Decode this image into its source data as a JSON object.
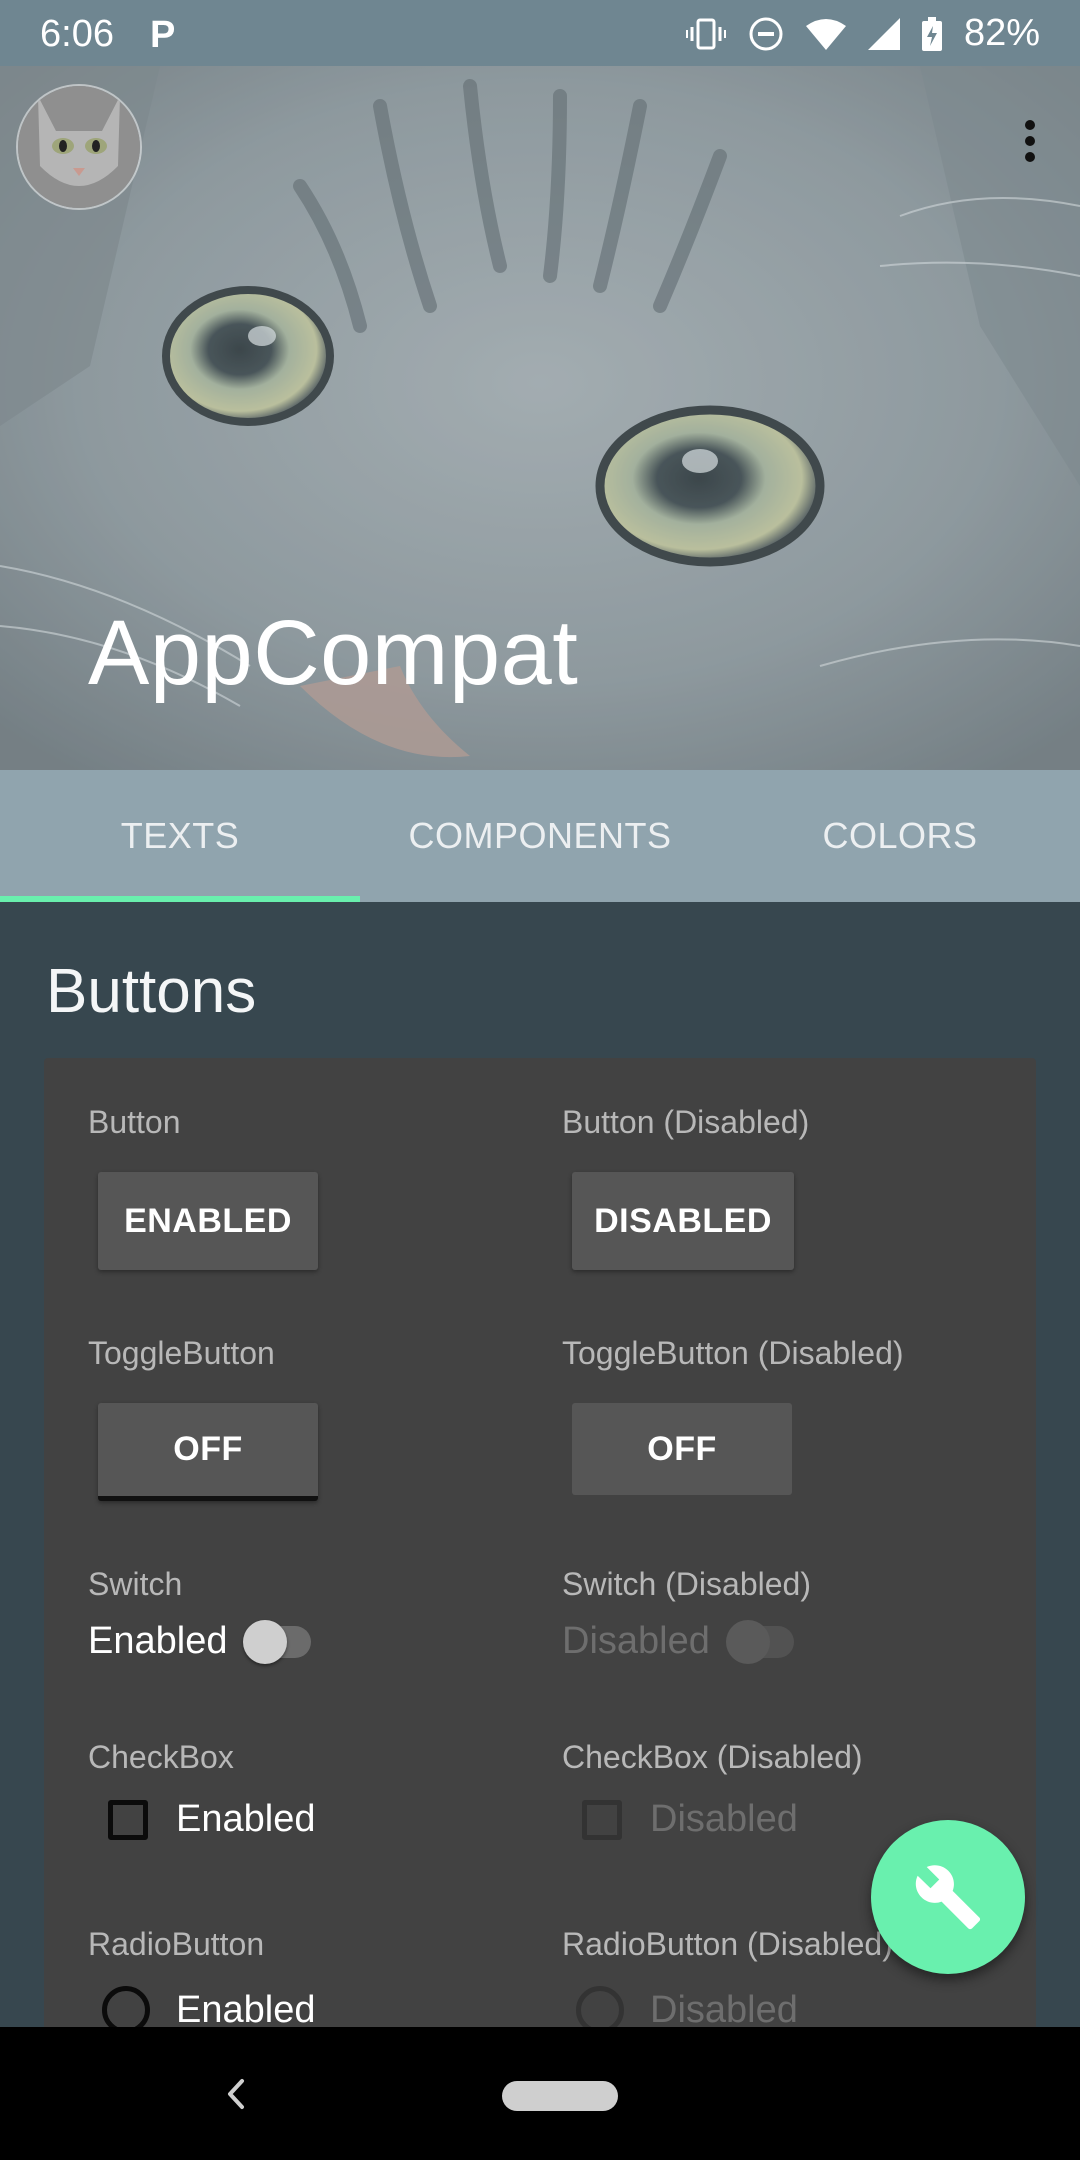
{
  "status_bar": {
    "time": "6:06",
    "app_icon": "P",
    "battery_percent": "82%",
    "icons": [
      "vibrate-icon",
      "dnd-icon",
      "wifi-icon",
      "signal-icon",
      "battery-charging-icon"
    ]
  },
  "header": {
    "title": "AppCompat",
    "avatar_icon": "cat-avatar",
    "menu_icon": "more-vert-icon"
  },
  "tabs": [
    {
      "label": "TEXTS",
      "active": true
    },
    {
      "label": "COMPONENTS",
      "active": false
    },
    {
      "label": "COLORS",
      "active": false
    }
  ],
  "colors": {
    "accent": "#69f0ae",
    "tab_bar": "#90a4ae",
    "background": "#37474f",
    "card": "#424242"
  },
  "section": {
    "title": "Buttons",
    "button": {
      "label": "Button",
      "value": "ENABLED"
    },
    "button_disabled": {
      "label": "Button (Disabled)",
      "value": "DISABLED"
    },
    "toggle": {
      "label": "ToggleButton",
      "value": "OFF"
    },
    "toggle_disabled": {
      "label": "ToggleButton (Disabled)",
      "value": "OFF"
    },
    "switch": {
      "label": "Switch",
      "text": "Enabled",
      "checked": false
    },
    "switch_disabled": {
      "label": "Switch (Disabled)",
      "text": "Disabled",
      "checked": false
    },
    "checkbox": {
      "label": "CheckBox",
      "text": "Enabled",
      "checked": false
    },
    "checkbox_disabled": {
      "label": "CheckBox (Disabled)",
      "text": "Disabled",
      "checked": false
    },
    "radio": {
      "label": "RadioButton",
      "text": "Enabled",
      "checked": false
    },
    "radio_disabled": {
      "label": "RadioButton (Disabled)",
      "text": "Disabled",
      "checked": false
    }
  },
  "fab": {
    "icon": "wrench-icon"
  },
  "nav_bar": {
    "back_icon": "back-icon",
    "home_icon": "home-pill-icon"
  }
}
